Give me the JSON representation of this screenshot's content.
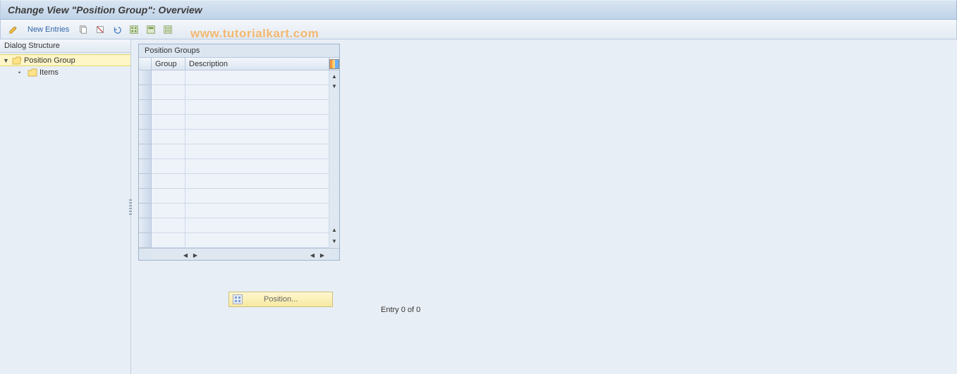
{
  "titlebar": {
    "text": "Change View \"Position Group\": Overview"
  },
  "toolbar": {
    "new_entries_label": "New Entries"
  },
  "watermark": {
    "text": "www.tutorialkart.com"
  },
  "sidebar": {
    "header": "Dialog Structure",
    "nodes": [
      {
        "label": "Position Group",
        "selected": true,
        "expanded": true
      },
      {
        "label": "Items",
        "parent": 0
      }
    ]
  },
  "table": {
    "title": "Position Groups",
    "columns": [
      "Group",
      "Description"
    ],
    "row_count": 12
  },
  "position_button": {
    "label": "Position..."
  },
  "status": {
    "entry_text": "Entry 0 of 0"
  }
}
